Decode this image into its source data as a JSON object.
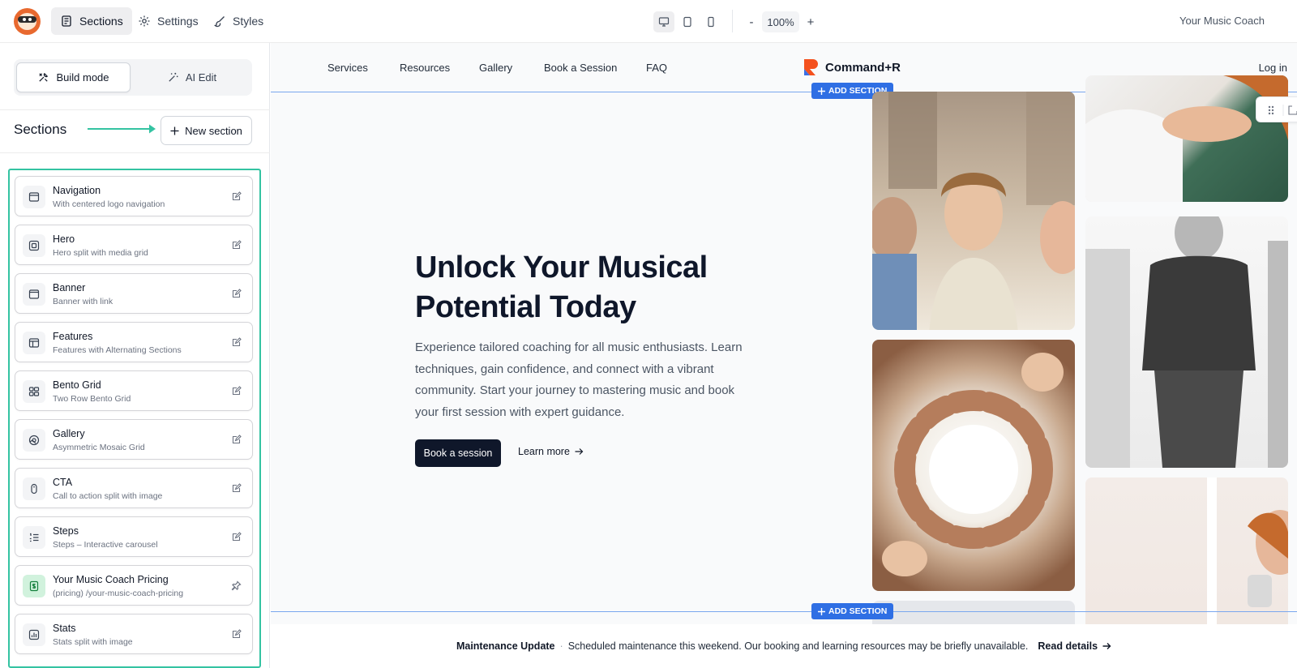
{
  "topbar": {
    "tabs": [
      {
        "label": "Sections"
      },
      {
        "label": "Settings"
      },
      {
        "label": "Styles"
      }
    ],
    "zoom": "100%",
    "zoom_minus": "-",
    "zoom_plus": "+",
    "site_name": "Your Music Coach"
  },
  "sidebar": {
    "modes": [
      {
        "label": "Build mode"
      },
      {
        "label": "AI Edit"
      }
    ],
    "title": "Sections",
    "new_section_label": "New section",
    "sections": [
      {
        "title": "Navigation",
        "subtitle": "With centered logo navigation"
      },
      {
        "title": "Hero",
        "subtitle": "Hero split with media grid"
      },
      {
        "title": "Banner",
        "subtitle": "Banner with link"
      },
      {
        "title": "Features",
        "subtitle": "Features with Alternating Sections"
      },
      {
        "title": "Bento Grid",
        "subtitle": "Two Row Bento Grid"
      },
      {
        "title": "Gallery",
        "subtitle": "Asymmetric Mosaic Grid"
      },
      {
        "title": "CTA",
        "subtitle": "Call to action split with image"
      },
      {
        "title": "Steps",
        "subtitle": "Steps – Interactive carousel"
      },
      {
        "title": "Your Music Coach Pricing",
        "subtitle": "(pricing) /your-music-coach-pricing"
      },
      {
        "title": "Stats",
        "subtitle": "Stats split with image"
      }
    ]
  },
  "site": {
    "nav": [
      "Services",
      "Resources",
      "Gallery",
      "Book a Session",
      "FAQ"
    ],
    "brand": "Command+R",
    "login": "Log in",
    "add_section": "ADD SECTION",
    "hero": {
      "title": "Unlock Your Musical Potential Today",
      "description": "Experience tailored coaching for all music enthusiasts. Learn techniques, gain confidence, and connect with a vibrant community. Start your journey to mastering music and book your first session with expert guidance.",
      "primary_cta": "Book a session",
      "secondary_cta": "Learn more"
    },
    "banner": {
      "title": "Maintenance Update",
      "separator": "·",
      "text": "Scheduled maintenance this weekend. Our booking and learning resources may be briefly unavailable.",
      "link": "Read details"
    }
  },
  "colors": {
    "accent_green": "#34c3a2",
    "selection_blue": "#2f6fe4",
    "primary_dark": "#0f172a"
  }
}
